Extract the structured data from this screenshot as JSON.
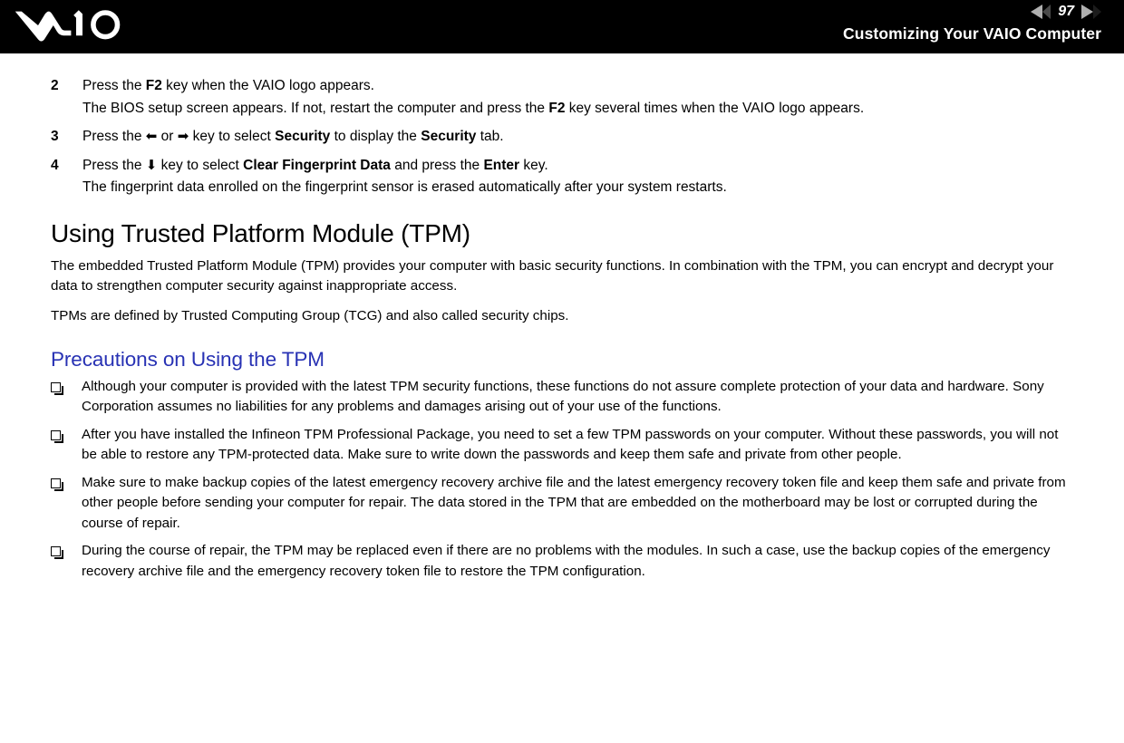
{
  "header": {
    "logo_alt": "VAIO",
    "page_number": "97",
    "prev_icon": "left-triangle-icon",
    "next_icon": "right-triangle-icon",
    "title": "Customizing Your VAIO Computer"
  },
  "steps": [
    {
      "number": "2",
      "line1_a": "Press the ",
      "line1_key": "F2",
      "line1_b": " key when the VAIO logo appears.",
      "line2_a": "The BIOS setup screen appears. If not, restart the computer and press the ",
      "line2_key": "F2",
      "line2_b": " key several times when the VAIO logo appears."
    },
    {
      "number": "3",
      "line1_a": "Press the ",
      "arrow_left": "⬅",
      "mid_or": " or ",
      "arrow_right": "➡",
      "line1_b": " key to select ",
      "key1": "Security",
      "line1_c": " to display the ",
      "key2": "Security",
      "line1_d": " tab."
    },
    {
      "number": "4",
      "line1_a": "Press the ",
      "arrow_down": "⬇",
      "line1_b": " key to select ",
      "key1": "Clear Fingerprint Data",
      "line1_c": " and press the ",
      "key2": "Enter",
      "line1_d": " key.",
      "line2": "The fingerprint data enrolled on the fingerprint sensor is erased automatically after your system restarts."
    }
  ],
  "section": {
    "title": "Using Trusted Platform Module (TPM)",
    "paragraphs": [
      "The embedded Trusted Platform Module (TPM) provides your computer with basic security functions. In combination with the TPM, you can encrypt and decrypt your data to strengthen computer security against inappropriate access.",
      "TPMs are defined by Trusted Computing Group (TCG) and also called security chips."
    ],
    "subtitle": "Precautions on Using the TPM",
    "bullets": [
      "Although your computer is provided with the latest TPM security functions, these functions do not assure complete protection of your data and hardware. Sony Corporation assumes no liabilities for any problems and damages arising out of your use of the functions.",
      "After you have installed the Infineon TPM Professional Package, you need to set a few TPM passwords on your computer. Without these passwords, you will not be able to restore any TPM-protected data. Make sure to write down the passwords and keep them safe and private from other people.",
      "Make sure to make backup copies of the latest emergency recovery archive file and the latest emergency recovery token file and keep them safe and private from other people before sending your computer for repair. The data stored in the TPM that are embedded on the motherboard may be lost or corrupted during the course of repair.",
      "During the course of repair, the TPM may be replaced even if there are no problems with the modules. In such a case, use the backup copies of the emergency recovery archive file and the emergency recovery token file to restore the TPM configuration."
    ]
  },
  "colors": {
    "header_bg": "#000000",
    "subtitle_blue": "#2832b4",
    "arrow_light": "#b0b0b0"
  }
}
